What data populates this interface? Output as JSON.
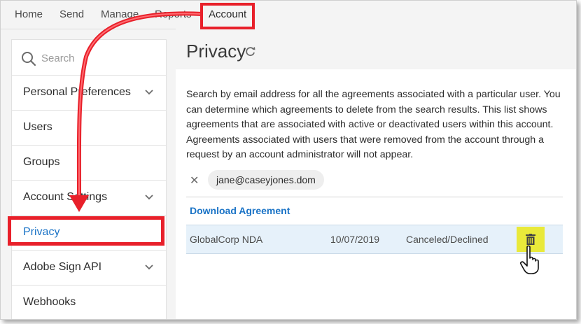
{
  "nav": {
    "home": "Home",
    "send": "Send",
    "manage": "Manage",
    "reports": "Reports",
    "account": "Account"
  },
  "sidebar": {
    "search_placeholder": "Search",
    "items": [
      {
        "label": "Personal Preferences"
      },
      {
        "label": "Users"
      },
      {
        "label": "Groups"
      },
      {
        "label": "Account Settings"
      },
      {
        "label": "Privacy"
      },
      {
        "label": "Adobe Sign API"
      },
      {
        "label": "Webhooks"
      }
    ]
  },
  "main": {
    "title": "Privacy",
    "description": "Search by email address for all the agreements associated with a particular user. You can determine which agreements to delete from the search results. This list shows agreements that are associated with active or deactivated users within this account. Agreements associated with users that were removed from the account through a request by an account administrator will not appear.",
    "clear_glyph": "✕",
    "search_email": "jane@caseyjones.dom",
    "download_label": "Download Agreement",
    "rows": [
      {
        "name": "GlobalCorp NDA",
        "date": "10/07/2019",
        "status": "Canceled/Declined"
      }
    ]
  },
  "colors": {
    "accent": "#1a73c6",
    "highlight": "#e8202a",
    "delete_bg": "#e9e93a",
    "row_selected": "#e6f1fa"
  },
  "icons": [
    "search-icon",
    "chevron-down-icon",
    "refresh-icon",
    "close-icon",
    "trash-icon",
    "hand-cursor-icon",
    "arrow-annotation"
  ]
}
